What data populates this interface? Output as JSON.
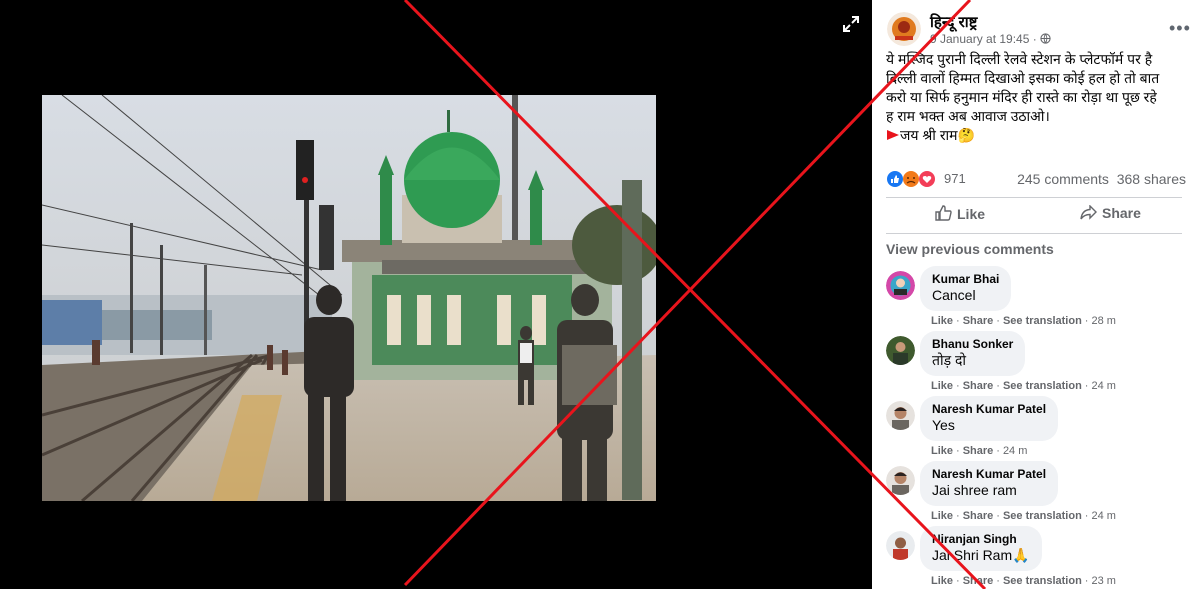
{
  "post": {
    "page_name": "हिन्दू राष्ट्र",
    "time": "9 January at 19:45 · ",
    "text_lines": [
      "ये मस्जिद पुरानी दिल्ली रेलवे स्टेशन के प्लेटफॉर्म पर है",
      "दिल्ली वालों हिम्मत दिखाओ इसका कोई हल हो तो बात",
      "करो या सिर्फ हनुमान मंदिर ही रास्ते का रोड़ा था पूछ रहे",
      "ह राम भक्त अब आवाज उठाओ।"
    ],
    "last_line": "जय श्री राम",
    "reaction_count": "971",
    "comments_count": "245 comments",
    "shares_count": "368 shares",
    "like_label": "Like",
    "share_label": "Share",
    "view_previous": "View previous comments"
  },
  "comments": [
    {
      "name": "Kumar Bhai",
      "text": "Cancel",
      "like": "Like",
      "share": "Share",
      "translate": "See translation",
      "time": "28 m"
    },
    {
      "name": "Bhanu Sonker",
      "text": "तोड़ दो",
      "like": "Like",
      "share": "Share",
      "translate": "See translation",
      "time": "24 m"
    },
    {
      "name": "Naresh Kumar Patel",
      "text": "Yes",
      "like": "Like",
      "share": "Share",
      "translate": "",
      "time": "24 m"
    },
    {
      "name": "Naresh Kumar Patel",
      "text": "Jai shree ram",
      "like": "Like",
      "share": "Share",
      "translate": "See translation",
      "time": "24 m"
    },
    {
      "name": "Niranjan Singh",
      "text": "Jai Shri Ram🙏",
      "like": "Like",
      "share": "Share",
      "translate": "See translation",
      "time": "23 m"
    }
  ],
  "colors": {
    "cross": "#e8141c",
    "reaction_count": "#65676b"
  },
  "icons": [
    "expand-icon",
    "more-icon",
    "globe-icon",
    "like-icon",
    "share-icon",
    "flag-icon"
  ]
}
